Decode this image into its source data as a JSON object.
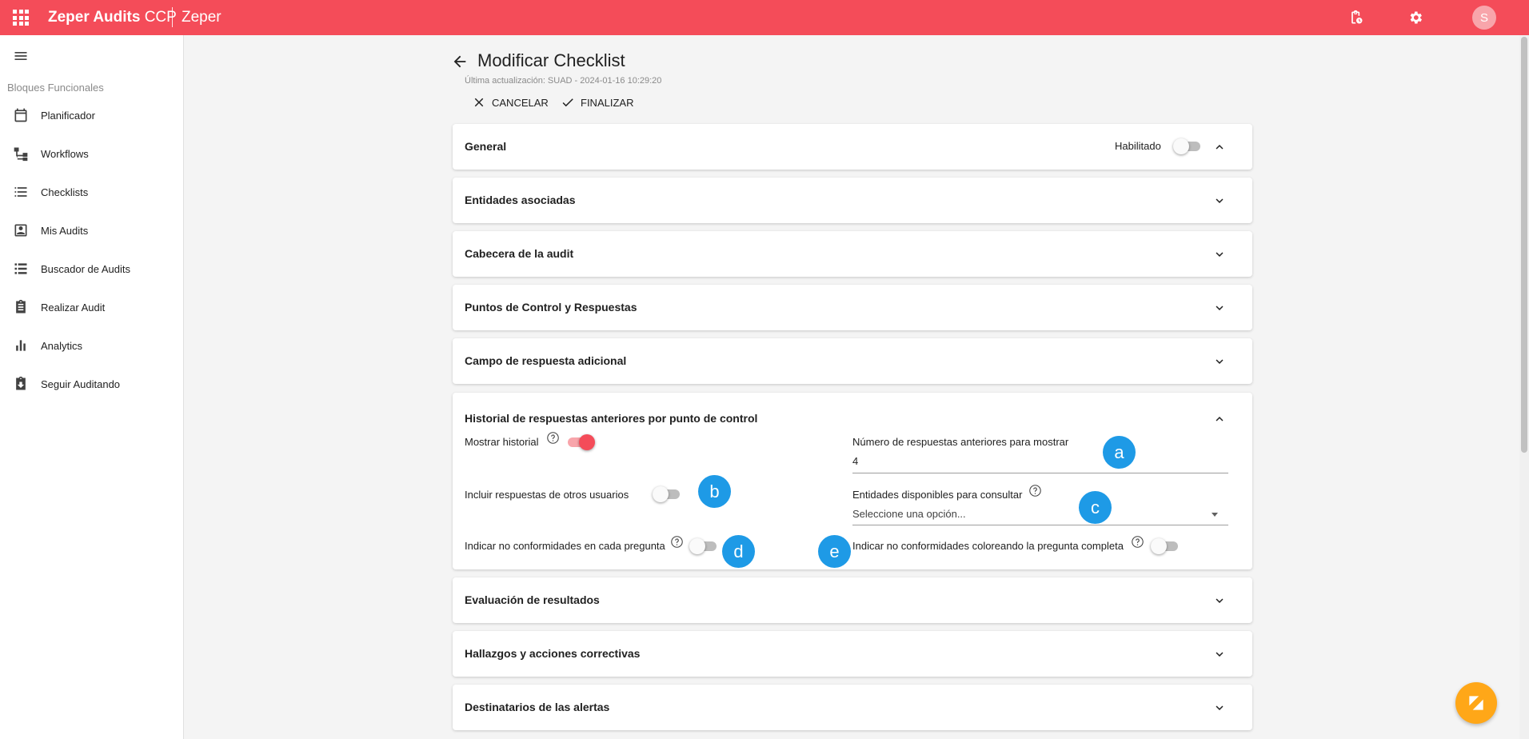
{
  "topbar": {
    "brand_name": "Zeper Audits",
    "brand_suffix": "CCP",
    "tenant": "Zeper",
    "avatar_initial": "S",
    "icons": [
      "apps-grid-icon",
      "clipboard-clock-icon",
      "gear-icon"
    ],
    "color": "#f44c59"
  },
  "sidebar": {
    "section_label": "Bloques Funcionales",
    "items": [
      {
        "label": "Planificador",
        "icon": "calendar-icon"
      },
      {
        "label": "Workflows",
        "icon": "workflow-icon"
      },
      {
        "label": "Checklists",
        "icon": "list-icon"
      },
      {
        "label": "Mis Audits",
        "icon": "person-box-icon"
      },
      {
        "label": "Buscador de Audits",
        "icon": "stacked-list-icon"
      },
      {
        "label": "Realizar Audit",
        "icon": "clipboard-icon"
      },
      {
        "label": "Analytics",
        "icon": "bar-chart-icon"
      },
      {
        "label": "Seguir Auditando",
        "icon": "archive-download-icon"
      }
    ]
  },
  "page": {
    "title": "Modificar Checklist",
    "last_update": "Última actualización: SUAD - 2024-01-16 10:29:20",
    "cancel_label": "CANCELAR",
    "finish_label": "FINALIZAR"
  },
  "panels": {
    "general": {
      "title": "General",
      "enabled_label": "Habilitado",
      "enabled": false
    },
    "entities": {
      "title": "Entidades asociadas"
    },
    "header": {
      "title": "Cabecera de la audit"
    },
    "control_points": {
      "title": "Puntos de Control y Respuestas"
    },
    "additional_field": {
      "title": "Campo de respuesta adicional"
    },
    "history": {
      "title": "Historial de respuestas anteriores por punto de control",
      "show_history_label": "Mostrar historial",
      "show_history": true,
      "prev_count_label": "Número de respuestas anteriores para mostrar",
      "prev_count_value": "4",
      "include_others_label": "Incluir respuestas de otros usuarios",
      "include_others": false,
      "entities_label": "Entidades disponibles para consultar",
      "entities_placeholder": "Seleccione una opción...",
      "nonconf_each_label": "Indicar no conformidades en cada pregunta",
      "nonconf_each": false,
      "nonconf_color_label": "Indicar no conformidades coloreando la pregunta completa",
      "nonconf_color": false
    },
    "evaluation": {
      "title": "Evaluación de resultados"
    },
    "findings": {
      "title": "Hallazgos y acciones correctivas"
    },
    "recipients": {
      "title": "Destinatarios de las alertas"
    }
  },
  "markers": [
    "a",
    "b",
    "c",
    "d",
    "e"
  ]
}
